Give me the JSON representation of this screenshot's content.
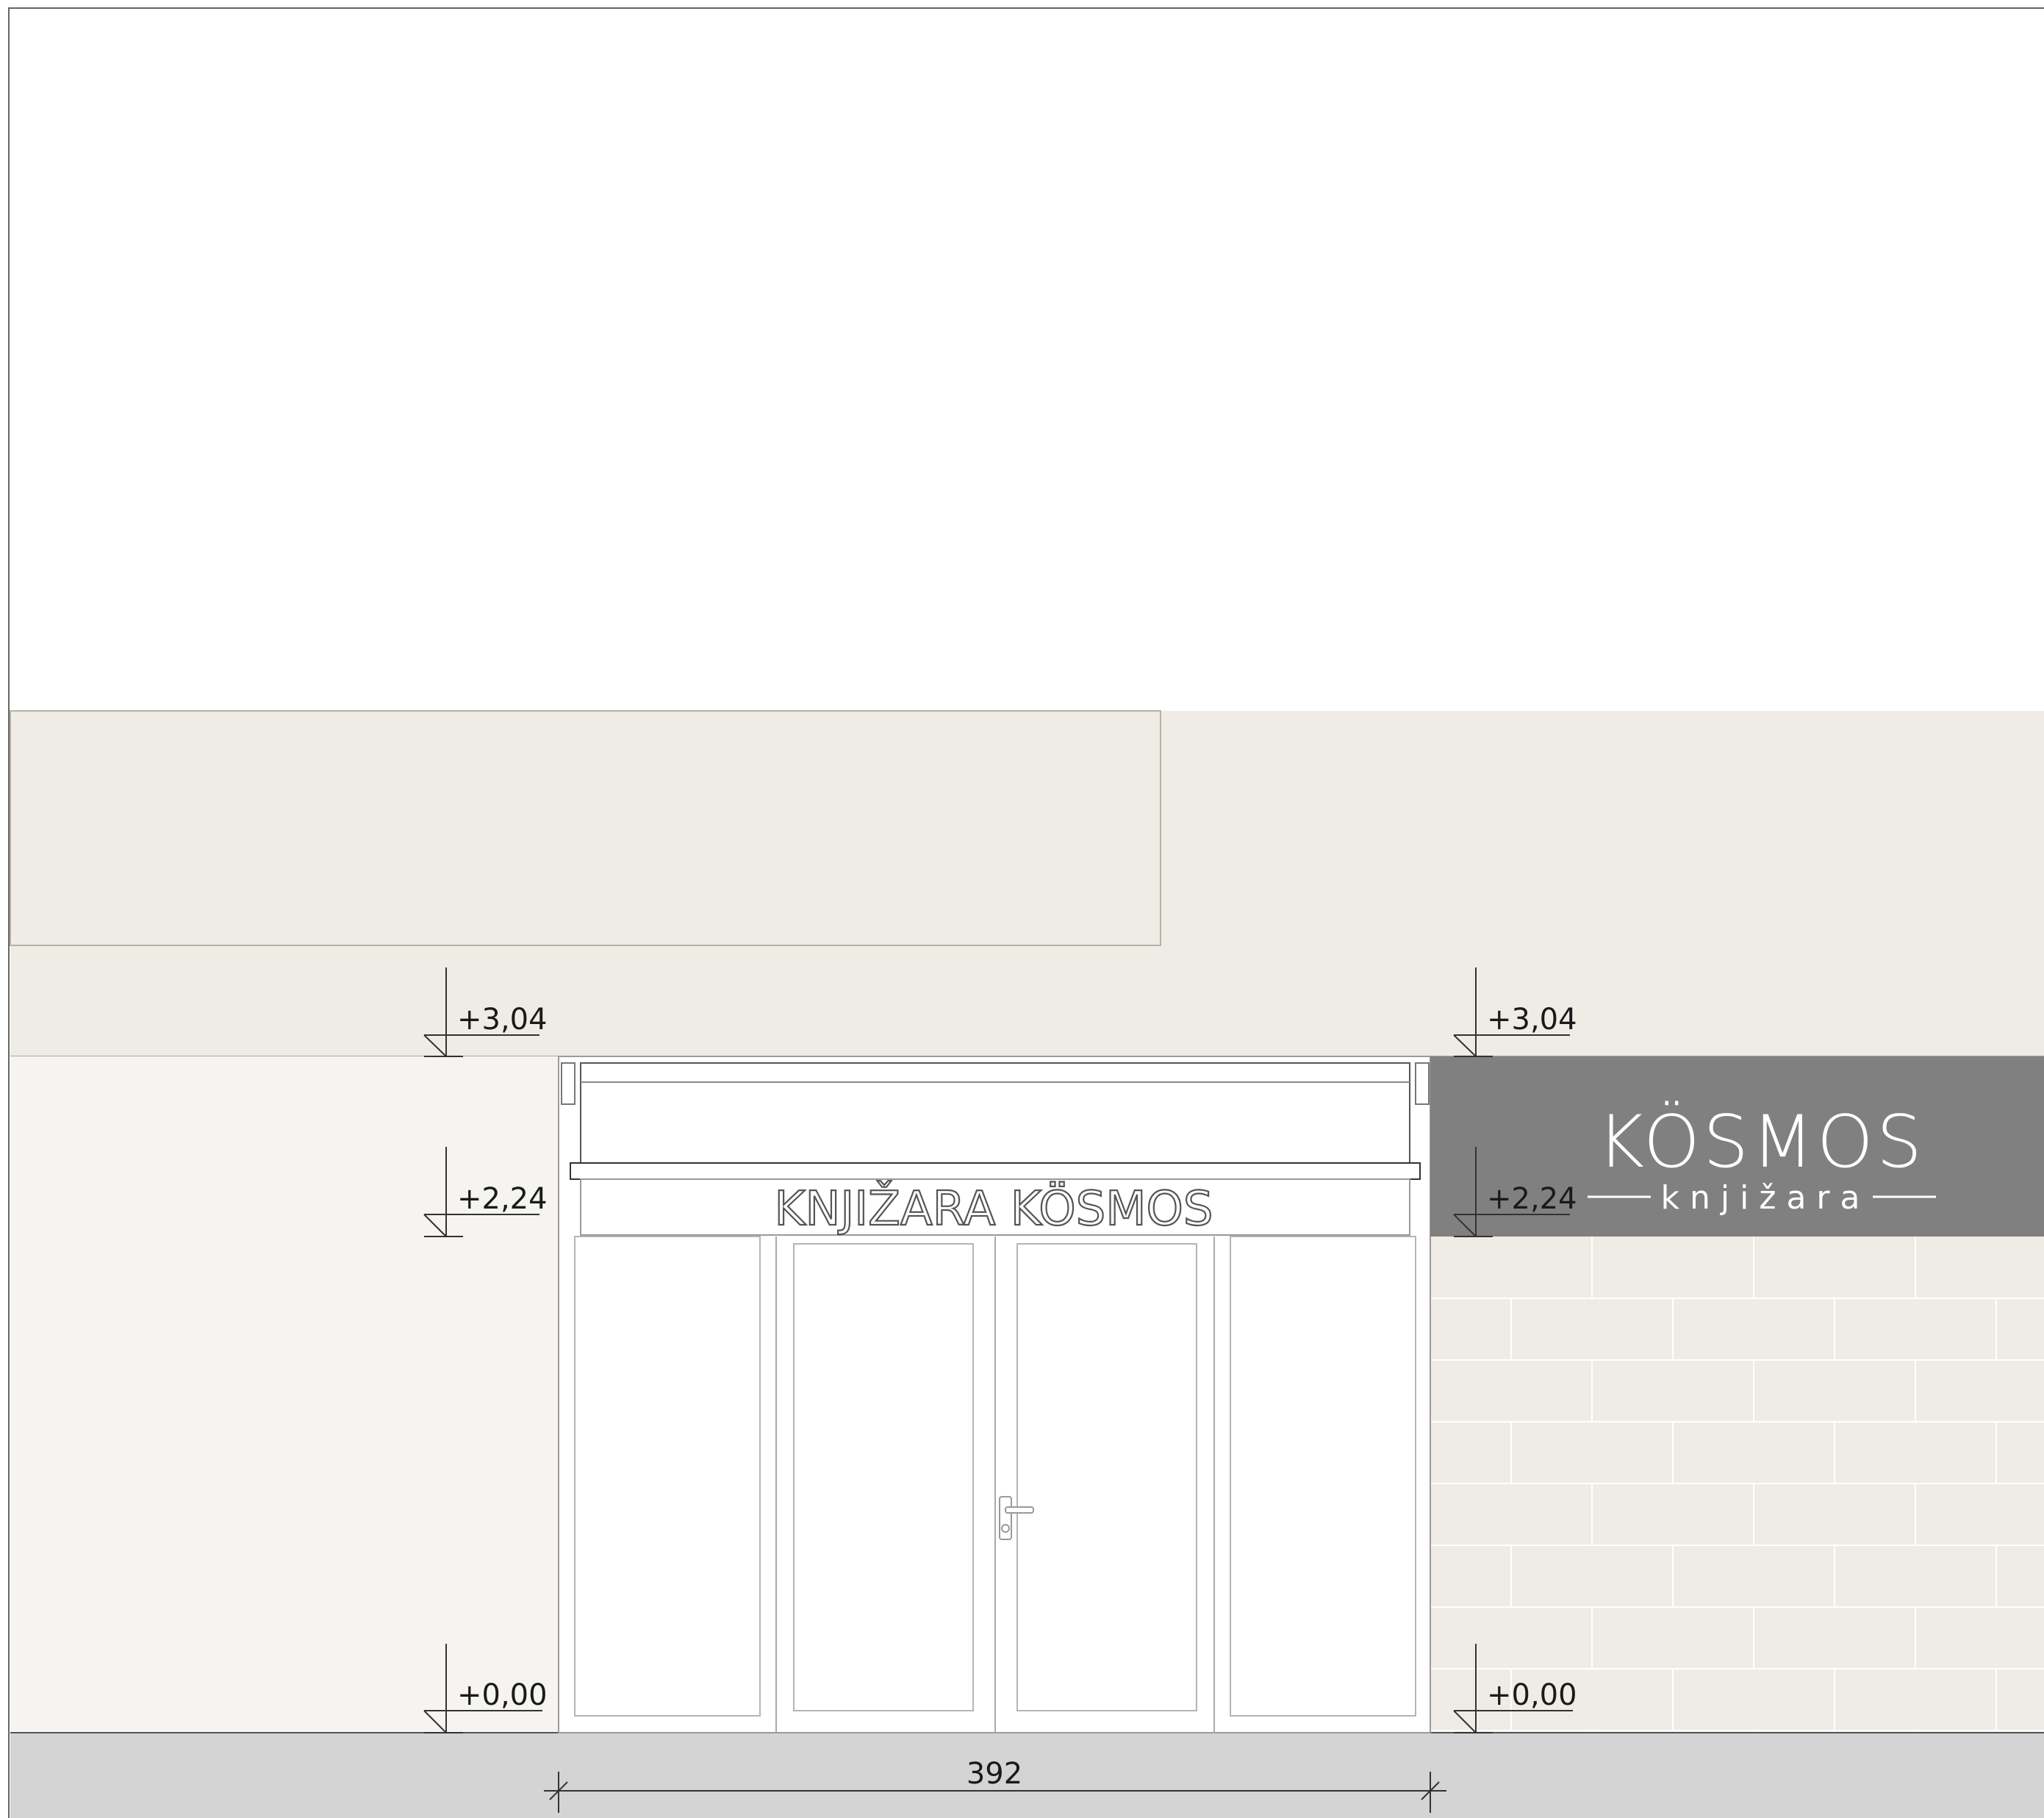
{
  "facade": {
    "fascia_text": "KNJIŽARA KÖSMOS",
    "elevations": {
      "top": "+3,04",
      "mid": "+2,24",
      "ground": "+0,00"
    },
    "width_dimension": "392",
    "sign": {
      "brand": "KÖSMOS",
      "subtitle": "knjižara",
      "background_color": "#808080",
      "text_color": "#ffffff"
    },
    "colors": {
      "upper_wall": "#efece5",
      "left_wall": "#f5f4f0",
      "brick_wall": "#efece5",
      "sidewalk": "#d4d4d4",
      "line": "#888888"
    }
  }
}
